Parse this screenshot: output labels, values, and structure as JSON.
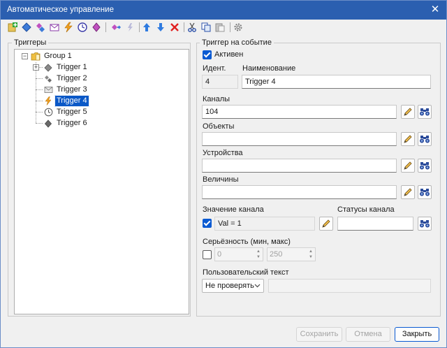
{
  "window": {
    "title": "Автоматическое управление",
    "close_glyph": "✕"
  },
  "toolbar": {
    "icons": [
      "new-trigger-icon",
      "add-diamond-icon",
      "add-channel-icon",
      "add-message-icon",
      "add-lightning-icon",
      "add-clock-icon",
      "add-object-icon",
      "add-group-icon",
      "add-star-icon",
      "move-up-icon",
      "move-down-icon",
      "delete-icon",
      "cut-icon",
      "copy-icon",
      "paste-icon",
      "settings-icon"
    ]
  },
  "triggers_panel": {
    "title": "Триггеры",
    "tree": {
      "group": {
        "label": "Group 1",
        "icon": "folder-icon"
      },
      "items": [
        {
          "label": "Trigger 1",
          "icon": "diamond-icon",
          "expandable": true,
          "selected": false
        },
        {
          "label": "Trigger 2",
          "icon": "channel-icon",
          "expandable": false,
          "selected": false
        },
        {
          "label": "Trigger 3",
          "icon": "message-icon",
          "expandable": false,
          "selected": false
        },
        {
          "label": "Trigger 4",
          "icon": "lightning-icon",
          "expandable": false,
          "selected": true
        },
        {
          "label": "Trigger 5",
          "icon": "clock-icon",
          "expandable": false,
          "selected": false
        },
        {
          "label": "Trigger 6",
          "icon": "object-icon",
          "expandable": false,
          "selected": false
        }
      ]
    }
  },
  "event_panel": {
    "title": "Триггер на событие",
    "active_label": "Активен",
    "active_checked": true,
    "id_label": "Идент.",
    "id_value": "4",
    "name_label": "Наименование",
    "name_value": "Trigger 4",
    "channels_label": "Каналы",
    "channels_value": "104",
    "objects_label": "Объекты",
    "objects_value": "",
    "devices_label": "Устройства",
    "devices_value": "",
    "quantities_label": "Величины",
    "quantities_value": "",
    "channel_value_label": "Значение канала",
    "channel_value_checked": true,
    "channel_value_text": "Val = 1",
    "channel_status_label": "Статусы канала",
    "channel_status_value": "",
    "severity_label": "Серьёзность (мин, макс)",
    "severity_checked": false,
    "severity_min": "0",
    "severity_max": "250",
    "user_text_label": "Пользовательский текст",
    "user_text_mode": "Не проверять",
    "user_text_value": ""
  },
  "footer": {
    "save_label": "Сохранить",
    "cancel_label": "Отмена",
    "close_label": "Закрыть"
  },
  "colors": {
    "accent": "#0a5ad2",
    "title_bar": "#2b5fb0",
    "selection": "#0a58c7"
  }
}
